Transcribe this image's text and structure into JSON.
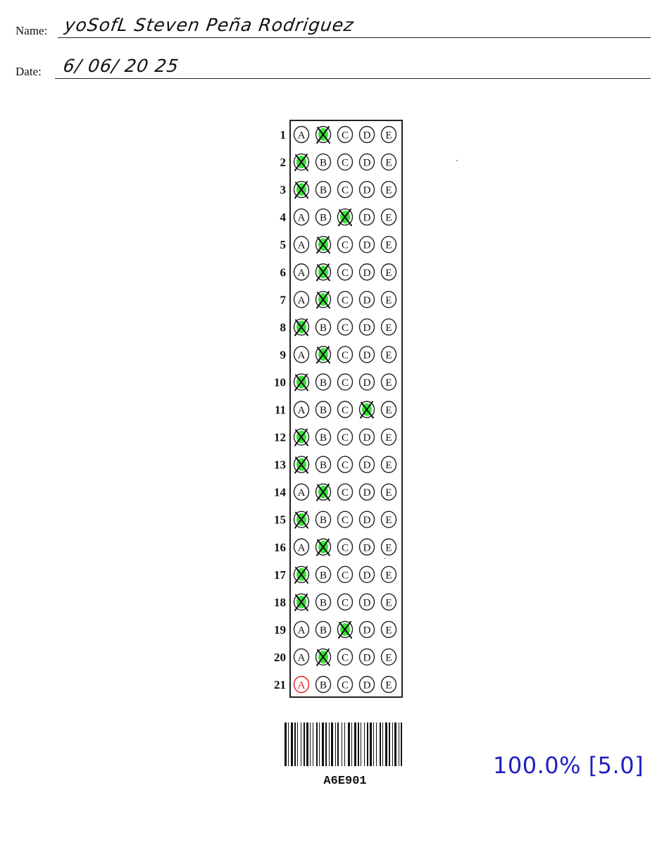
{
  "header": {
    "name_label": "Name:",
    "name_value": "yoSofL Steven Peña Rodriguez",
    "date_label": "Date:",
    "date_value": "6/ 06/ 20 25"
  },
  "sheet": {
    "options": [
      "A",
      "B",
      "C",
      "D",
      "E"
    ],
    "questions": [
      {
        "number": "1",
        "marked": "B",
        "status": "correct"
      },
      {
        "number": "2",
        "marked": "A",
        "status": "correct"
      },
      {
        "number": "3",
        "marked": "A",
        "status": "correct"
      },
      {
        "number": "4",
        "marked": "C",
        "status": "correct"
      },
      {
        "number": "5",
        "marked": "B",
        "status": "correct"
      },
      {
        "number": "6",
        "marked": "B",
        "status": "correct"
      },
      {
        "number": "7",
        "marked": "B",
        "status": "correct"
      },
      {
        "number": "8",
        "marked": "A",
        "status": "correct"
      },
      {
        "number": "9",
        "marked": "B",
        "status": "correct"
      },
      {
        "number": "10",
        "marked": "A",
        "status": "correct"
      },
      {
        "number": "11",
        "marked": "D",
        "status": "correct"
      },
      {
        "number": "12",
        "marked": "A",
        "status": "correct"
      },
      {
        "number": "13",
        "marked": "A",
        "status": "correct"
      },
      {
        "number": "14",
        "marked": "B",
        "status": "correct"
      },
      {
        "number": "15",
        "marked": "A",
        "status": "correct"
      },
      {
        "number": "16",
        "marked": "B",
        "status": "correct"
      },
      {
        "number": "17",
        "marked": "A",
        "status": "correct"
      },
      {
        "number": "18",
        "marked": "A",
        "status": "correct"
      },
      {
        "number": "19",
        "marked": "C",
        "status": "correct"
      },
      {
        "number": "20",
        "marked": "B",
        "status": "correct"
      },
      {
        "number": "21",
        "marked": "A",
        "status": "unanswered"
      }
    ]
  },
  "barcode": {
    "text": "A6E901"
  },
  "score": {
    "text": "100.0% [5.0]"
  },
  "colors": {
    "correct_fill": "#33e633",
    "unanswered_key": "#e02020",
    "score_text": "#1f1fbf",
    "ink": "#111111"
  }
}
